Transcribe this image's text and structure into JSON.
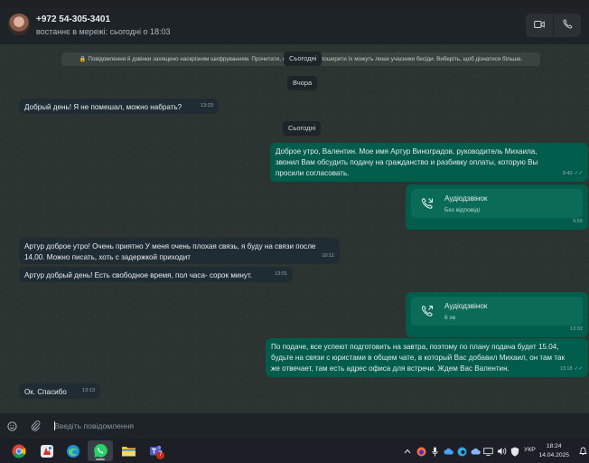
{
  "header": {
    "contact_name": "+972 54-305-3401",
    "status": "востаннє в мережі: сьогодні о 18:03",
    "video_icon": "video-camera-icon",
    "call_icon": "phone-icon"
  },
  "chat": {
    "encryption_notice": "🔒 Повідомлення й дзвінки захищено наскрізним шифруванням. Прочитати, що не можуть поширити їх можуть лише учасники бесіди. Виберіть, щоб дізнатися більше.",
    "date_chips": [
      "Сьогодні",
      "Вчора",
      "Сьогодні"
    ],
    "messages": [
      {
        "dir": "in",
        "text": "Добрый день! Я не помешал, можно набрать?",
        "time": "13:23"
      },
      {
        "dir": "out",
        "text": "Доброе утро, Валентин. Мое имя Артур Виноградов, руководитель Михаила, звонил Вам обсудить подачу на гражданство и разбивку оплаты, которую Вы просили согласовать.",
        "time": "9:40"
      },
      {
        "dir": "out",
        "type": "call",
        "title": "Аудіодзвінок",
        "subtitle": "Без відповіді",
        "time": "9:55"
      },
      {
        "dir": "in",
        "text": "Артур доброе утро! Очень приятно У меня очень плохая связь, я буду на связи после 14,00. Можно писать, хоть с задержкой приходит",
        "time": "10:11"
      },
      {
        "dir": "in",
        "text": "Артур добрый день! Есть свободное время, пол часа- сорок минут.",
        "time": "13:01"
      },
      {
        "dir": "out",
        "type": "call",
        "title": "Аудіодзвінок",
        "subtitle": "6 хв",
        "time": "13:02"
      },
      {
        "dir": "out",
        "text": "По подаче, все успеют подготовить на завтра, поэтому по плану подача будет 15.04, будьте на связи с юристами в общем чате, в который Вас добавил Михаил, он там так же отвечает, там есть адрес офиса для встречи. Ждем Вас Валентин.",
        "time": "13:18"
      },
      {
        "dir": "in",
        "text": "Ок.  Спасибо",
        "time": "13:13"
      }
    ]
  },
  "composer": {
    "placeholder": "Введіть повідомлення",
    "emoji_icon": "emoji-icon",
    "attach_icon": "paperclip-icon"
  },
  "taskbar": {
    "apps": [
      "chrome-icon",
      "photos-icon",
      "edge-icon",
      "whatsapp-icon",
      "file-explorer-icon",
      "teams-icon"
    ],
    "teams_badge": "7",
    "language": "УКР",
    "time": "18:24",
    "date": "14.04.2025"
  },
  "colors": {
    "incoming_bubble": "#202c33",
    "outgoing_bubble": "#005c4b",
    "chat_background": "#2b3430",
    "read_tick": "#53bdeb"
  }
}
